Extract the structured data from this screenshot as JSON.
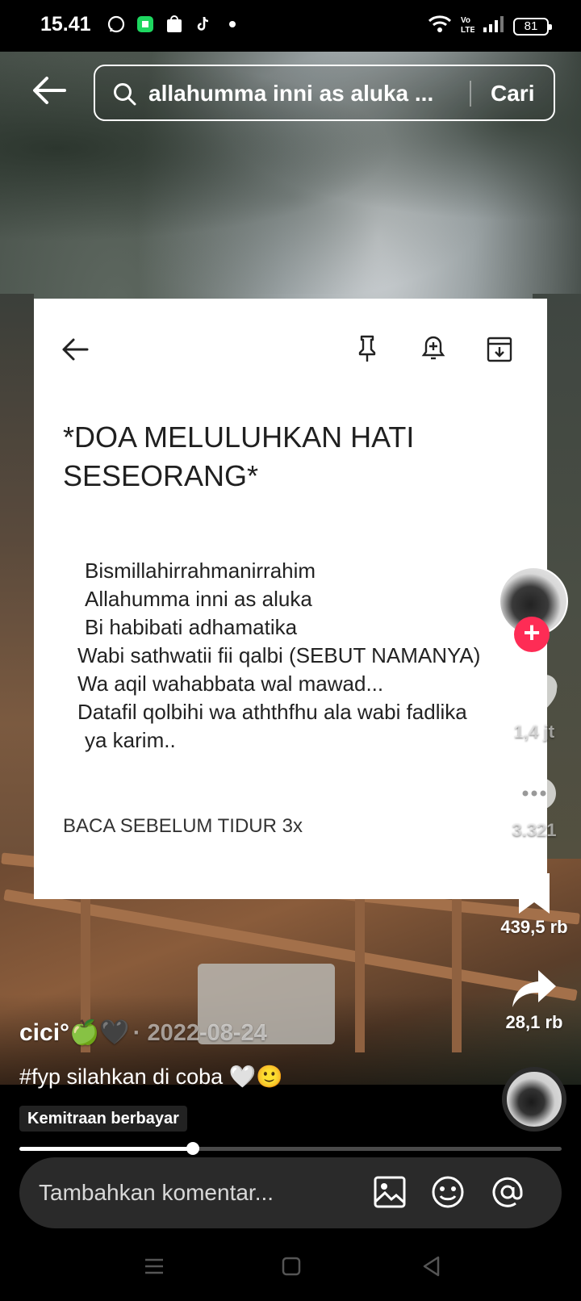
{
  "status_bar": {
    "time": "15.41",
    "battery": "81"
  },
  "search": {
    "query": "allahumma inni as aluka ...",
    "button_label": "Cari"
  },
  "note": {
    "title": "*DOA MELULUHKAN HATI SESEORANG*",
    "lines": [
      " Bismillahirrahmanirrahim",
      " Allahumma inni as aluka",
      " Bi habibati adhamatika",
      "Wabi sathwatii fii qalbi (SEBUT NAMANYA)",
      "Wa aqil wahabbata wal mawad...",
      "Datafil qolbihi wa aththfhu ala wabi fadlika",
      " ya karim.."
    ],
    "footer": "BACA SEBELUM TIDUR 3x"
  },
  "actions": {
    "likes": "1,4 jt",
    "comments": "3.321",
    "saves": "439,5 rb",
    "shares": "28,1 rb"
  },
  "caption": {
    "username": "cici°🍏🖤",
    "date": "· 2022-08-24",
    "text": "#fyp silahkan di coba 🤍🙂"
  },
  "paid_partnership": "Kemitraan berbayar",
  "progress": 0.32,
  "comment": {
    "placeholder": "Tambahkan komentar..."
  },
  "icons": [
    "back-arrow-icon",
    "search-icon",
    "pin-icon",
    "reminder-icon",
    "archive-icon",
    "heart-icon",
    "comment-icon",
    "bookmark-icon",
    "share-icon",
    "image-icon",
    "emoji-icon",
    "mention-icon"
  ],
  "colors": {
    "follow_accent": "#fe2c55",
    "comment_bar": "#2a2a2a"
  }
}
